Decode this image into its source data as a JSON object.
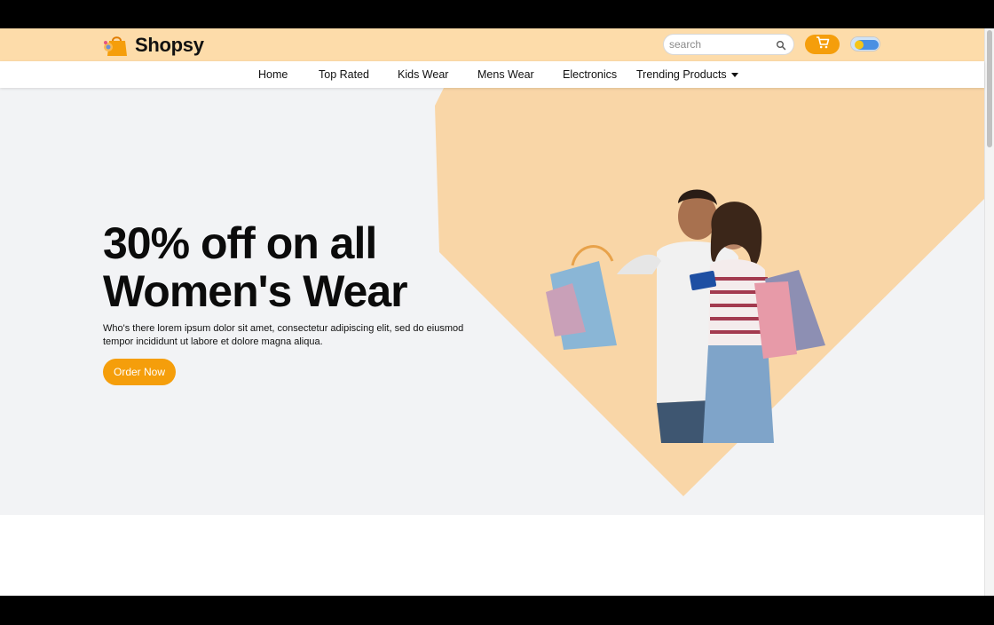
{
  "brand": {
    "name": "Shopsy"
  },
  "search": {
    "placeholder": "search"
  },
  "nav": {
    "items": [
      {
        "label": "Home"
      },
      {
        "label": "Top Rated"
      },
      {
        "label": "Kids Wear"
      },
      {
        "label": "Mens Wear"
      },
      {
        "label": "Electronics"
      },
      {
        "label": "Trending Products"
      }
    ]
  },
  "hero": {
    "title_line1": "30% off on all",
    "title_line2": "Women's Wear",
    "description": "Who's there lorem ipsum dolor sit amet, consectetur adipiscing elit, sed do eiusmod tempor incididunt ut labore et dolore magna aliqua.",
    "cta_label": "Order Now"
  },
  "icons": {
    "logo": "shopping-bag-icon",
    "search": "search-icon",
    "cart": "cart-icon",
    "theme": "theme-toggle-icon",
    "dropdown": "caret-down-icon"
  },
  "colors": {
    "topbar_bg": "#fddcaa",
    "accent": "#f59e0b",
    "hero_bg": "#f2f3f5",
    "hero_shape": "#f9d6a7",
    "text": "#0b0b0b"
  }
}
